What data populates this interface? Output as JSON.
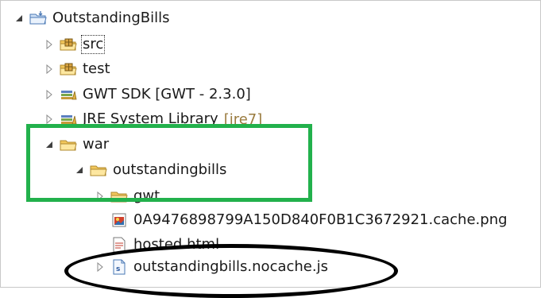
{
  "tree": {
    "project": {
      "label": "OutstandingBills",
      "icon": "project-folder-icon"
    },
    "src": {
      "label": "src",
      "icon": "package-folder-icon"
    },
    "test": {
      "label": "test",
      "icon": "package-folder-icon"
    },
    "gwt_sdk": {
      "label": "GWT SDK [GWT - 2.3.0]",
      "icon": "library-icon"
    },
    "jre": {
      "label": "JRE System Library",
      "decoration": "[jre7]",
      "icon": "library-icon"
    },
    "war": {
      "label": "war",
      "icon": "folder-icon"
    },
    "outstandingbills": {
      "label": "outstandingbills",
      "icon": "folder-icon"
    },
    "gwt": {
      "label": "gwt",
      "icon": "folder-icon"
    },
    "cache_png": {
      "label": "0A9476898799A150D840F0B1C3672921.cache.png",
      "icon": "image-file-icon"
    },
    "hosted": {
      "label": "hosted.html",
      "icon": "html-file-icon"
    },
    "nocache": {
      "label": "outstandingbills.nocache.js",
      "icon": "js-file-icon"
    }
  },
  "annotations": {
    "green_box_color": "#22b14c",
    "ellipse_color": "#000000"
  }
}
